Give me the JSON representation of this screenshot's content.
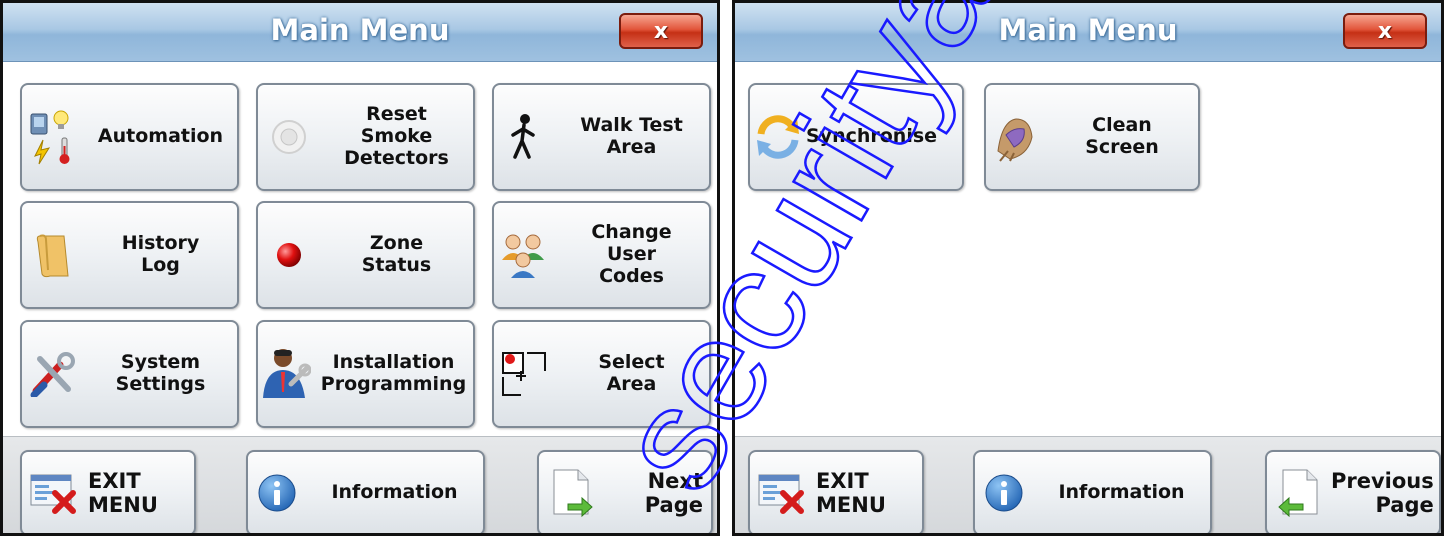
{
  "left": {
    "title": "Main Menu",
    "close_label": "x",
    "grid": {
      "automation": "Automation",
      "reset_smoke": [
        "Reset",
        "Smoke",
        "Detectors"
      ],
      "walk_test": [
        "Walk Test",
        "Area"
      ],
      "history_log": [
        "History",
        "Log"
      ],
      "zone_status": [
        "Zone",
        "Status"
      ],
      "change_codes": [
        "Change",
        "User",
        "Codes"
      ],
      "system_settings": [
        "System",
        "Settings"
      ],
      "installation": [
        "Installation",
        "Programming"
      ],
      "select_area": [
        "Select",
        "Area"
      ]
    },
    "bottom": {
      "exit": [
        "EXIT",
        "MENU"
      ],
      "information": "Information",
      "next": [
        "Next",
        "Page"
      ]
    }
  },
  "right": {
    "title": "Main Menu",
    "close_label": "x",
    "grid": {
      "synchronise": "Synchronise",
      "clean_screen": [
        "Clean",
        "Screen"
      ]
    },
    "bottom": {
      "exit": [
        "EXIT",
        "MENU"
      ],
      "information": "Information",
      "previous": [
        "Previous",
        "Page"
      ]
    }
  },
  "watermark": "securityalarms.com.au",
  "colors": {
    "titlebar": "#a9c8e4",
    "close_button": "#d2432a",
    "button_border": "#7f8a96",
    "watermark": "#1a1aff"
  }
}
